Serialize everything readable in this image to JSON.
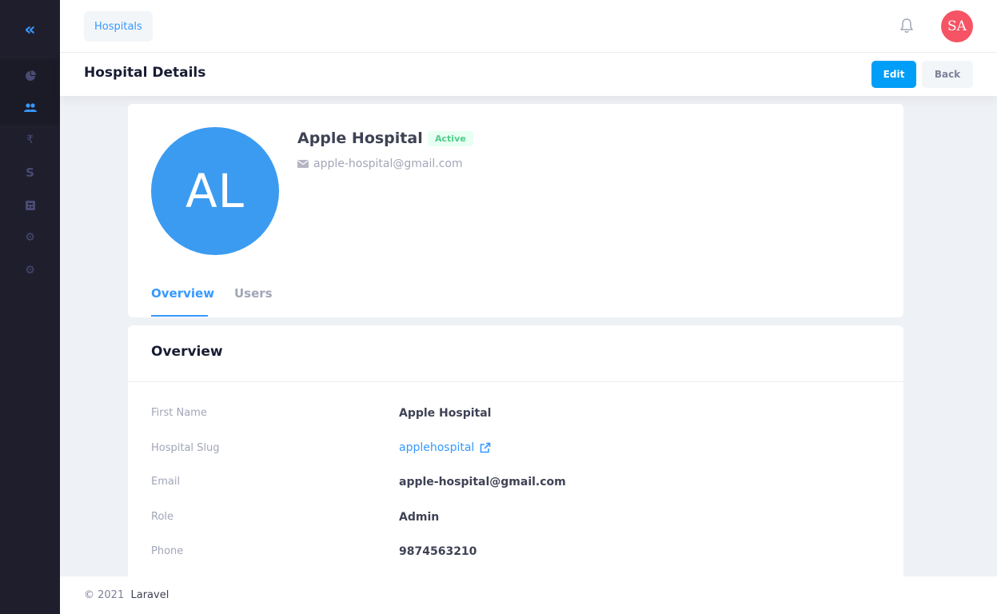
{
  "sidebar": {
    "toggle_icon": "double-chevron-left-icon",
    "items": [
      {
        "icon": "pie-chart-icon",
        "glyph": "◕"
      },
      {
        "icon": "users-icon",
        "glyph": "👥"
      },
      {
        "icon": "rupee-icon",
        "glyph": "₹"
      },
      {
        "icon": "dollar-icon",
        "glyph": "S"
      },
      {
        "icon": "calculator-icon",
        "glyph": "▦"
      },
      {
        "icon": "gear-icon",
        "glyph": "⚙"
      },
      {
        "icon": "gears-icon",
        "glyph": "⚙"
      }
    ]
  },
  "header": {
    "breadcrumb": "Hospitals",
    "user_initials": "SA"
  },
  "subheader": {
    "title": "Hospital Details",
    "edit_label": "Edit",
    "back_label": "Back"
  },
  "profile": {
    "initials": "AL",
    "name": "Apple Hospital",
    "status": "Active",
    "email": "apple-hospital@gmail.com",
    "tabs": [
      "Overview",
      "Users"
    ]
  },
  "overview": {
    "title": "Overview",
    "rows": [
      {
        "label": "First Name",
        "value": "Apple Hospital"
      },
      {
        "label": "Hospital Slug",
        "value": "applehospital"
      },
      {
        "label": "Email",
        "value": "apple-hospital@gmail.com"
      },
      {
        "label": "Role",
        "value": "Admin"
      },
      {
        "label": "Phone",
        "value": "9874563210"
      }
    ]
  },
  "footer": {
    "copyright": "© 2021",
    "brand": "Laravel"
  },
  "colors": {
    "accent": "#3699ff",
    "sidebar": "#1e1e2d",
    "edit_button": "#009ef7",
    "avatar": "#3b9bf0",
    "user_avatar": "#f65464",
    "active_badge_text": "#50cd89"
  }
}
